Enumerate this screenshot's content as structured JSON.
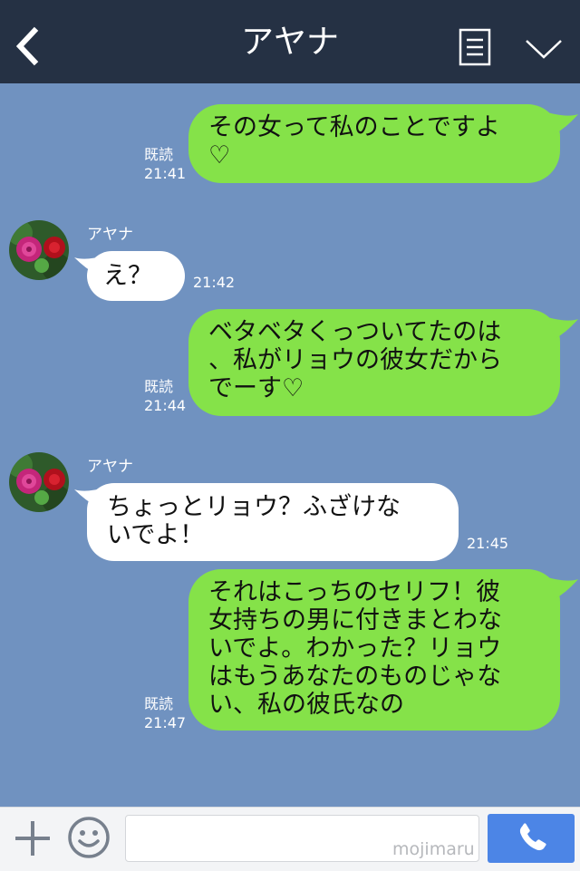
{
  "header": {
    "title": "アヤナ",
    "back_icon": "chevron-left-icon",
    "menu_icon": "document-list-icon",
    "expand_icon": "chevron-down-icon",
    "background": "#253144"
  },
  "chat": {
    "background": "#7092c0",
    "my_bubble_color": "#85e249",
    "their_bubble_color": "#ffffff",
    "messages": [
      {
        "sender": "me",
        "text": "その女って私のことですよ\n♡",
        "read_label": "既読",
        "time": "21:41"
      },
      {
        "sender": "アヤナ",
        "text": "え？",
        "time": "21:42"
      },
      {
        "sender": "me",
        "text": "ベタベタくっついてたのは\n、私がリョウの彼女だから\nでーす♡",
        "read_label": "既読",
        "time": "21:44"
      },
      {
        "sender": "アヤナ",
        "text": "ちょっとリョウ？ふざけな\nいでよ！",
        "time": "21:45"
      },
      {
        "sender": "me",
        "text": "それはこっちのセリフ！彼\n女持ちの男に付きまとわな\nいでよ。わかった？リョウ\nはもうあなたのものじゃな\nい、私の彼氏なの",
        "read_label": "既読",
        "time": "21:47"
      }
    ]
  },
  "footer": {
    "plus_icon": "plus-icon",
    "emoji_icon": "smiley-icon",
    "input_value": "",
    "input_placeholder": "",
    "watermark": "mojimaru",
    "call_icon": "phone-icon",
    "call_button_color": "#4c85e6"
  }
}
